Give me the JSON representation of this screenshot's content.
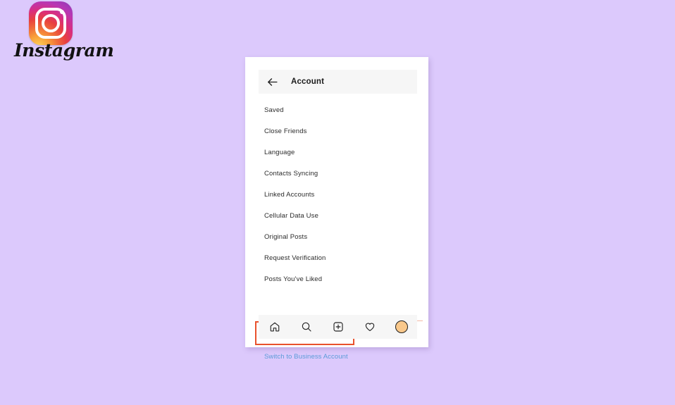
{
  "brand": {
    "logo_icon": "instagram-logo-icon",
    "wordmark": "Instagram",
    "gradient_colors": [
      "#fdd25c",
      "#f06d3a",
      "#e8403f",
      "#d92e7f",
      "#8a3ab9"
    ]
  },
  "page": {
    "background_color": "#dcc9fc",
    "panel_background": "#ffffff"
  },
  "app": {
    "header": {
      "back_icon": "back-arrow-icon",
      "title": "Account",
      "background_color": "#f6f6f6"
    },
    "settings_items": [
      {
        "label": "Saved"
      },
      {
        "label": "Close Friends"
      },
      {
        "label": "Language"
      },
      {
        "label": "Contacts Syncing"
      },
      {
        "label": "Linked Accounts"
      },
      {
        "label": "Cellular Data Use"
      },
      {
        "label": "Original Posts"
      },
      {
        "label": "Request Verification"
      },
      {
        "label": "Posts You've Liked"
      }
    ],
    "highlight": {
      "target_label": "Posts You've Liked",
      "border_color": "#e8512d"
    },
    "business_link": {
      "label": "Switch to Business Account",
      "color": "#5b9bd8"
    },
    "bottom_nav": [
      {
        "icon": "home-icon",
        "label": "Home"
      },
      {
        "icon": "search-icon",
        "label": "Search"
      },
      {
        "icon": "add-post-icon",
        "label": "New Post"
      },
      {
        "icon": "heart-icon",
        "label": "Activity"
      },
      {
        "icon": "profile-avatar-icon",
        "label": "Profile"
      }
    ],
    "avatar_color": "#f9c88b"
  }
}
